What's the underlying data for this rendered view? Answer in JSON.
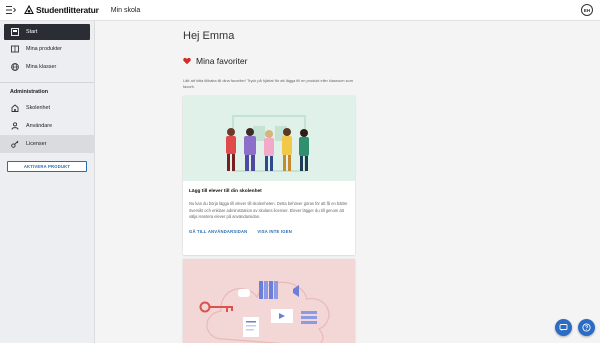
{
  "header": {
    "logo_text": "Studentlitteratur",
    "app_title": "Min skola",
    "avatar_initials": "EH"
  },
  "sidebar": {
    "items": [
      {
        "label": "Start",
        "icon": "home-icon"
      },
      {
        "label": "Mina produkter",
        "icon": "book-icon"
      },
      {
        "label": "Mina klasser",
        "icon": "globe-icon"
      }
    ],
    "admin_label": "Administration",
    "admin_items": [
      {
        "label": "Skolenhet",
        "icon": "school-icon"
      },
      {
        "label": "Användare",
        "icon": "user-icon"
      },
      {
        "label": "Licenser",
        "icon": "key-icon"
      }
    ],
    "activate_button": "AKTIVERA PRODUKT"
  },
  "main": {
    "greeting": "Hej Emma",
    "favorites_title": "Mina favoriter",
    "favorites_desc": "Lätt att hitta tillbaka till dina favoriter! Tryck på hjärtat för att lägga till en produkt eller klassrum som favorit.",
    "card1": {
      "title": "Lägg till elever till din skolenhet",
      "body": "Nu kan du börja lägga till elever till skolenheten. Detta behöver göras för att få en bättre översikt och enklare administration av skolans licenser. Elever lägger du till genom att välja Hantera elever på användarsidan.",
      "action1": "GÅ TILL ANVÄNDARSIDAN",
      "action2": "VISA INTE IGEN"
    }
  },
  "colors": {
    "accent": "#2b6cb0",
    "heart": "#d42b2b",
    "sidebar_active": "#2a2d33",
    "fab": "#2d6cc3"
  }
}
